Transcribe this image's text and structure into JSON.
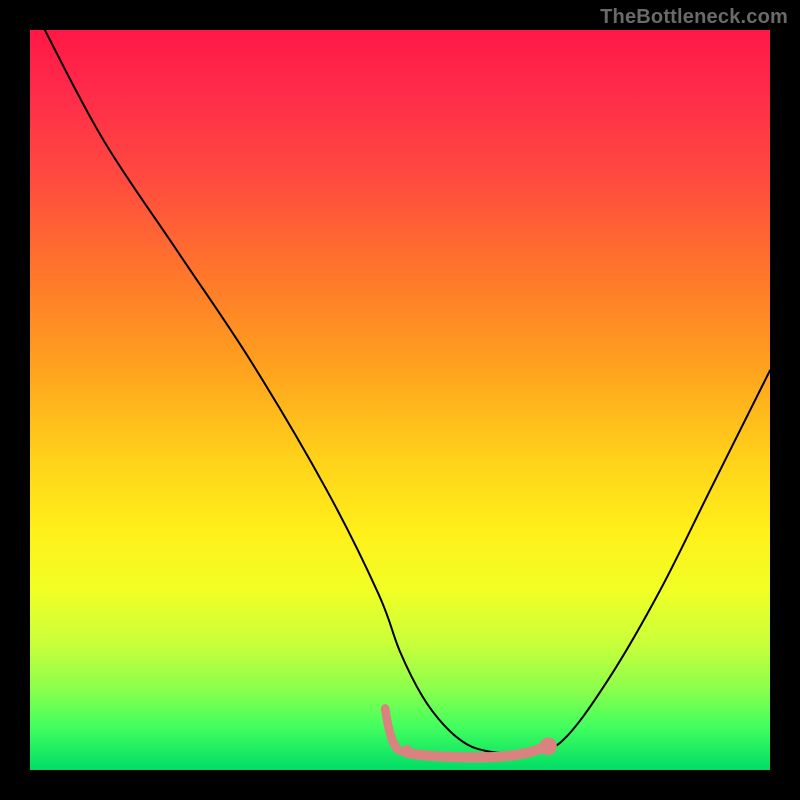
{
  "watermark": "TheBottleneck.com",
  "chart_data": {
    "type": "line",
    "title": "",
    "xlabel": "",
    "ylabel": "",
    "xlim": [
      0,
      100
    ],
    "ylim": [
      0,
      100
    ],
    "series": [
      {
        "name": "bottleneck-curve",
        "x": [
          2,
          10,
          20,
          30,
          40,
          47,
          50,
          53,
          56,
          59,
          62,
          65,
          68,
          72,
          78,
          85,
          92,
          100
        ],
        "y": [
          100,
          85,
          70,
          55,
          38,
          24,
          16,
          10,
          6,
          3.5,
          2.5,
          2.3,
          2.5,
          4,
          12,
          24,
          38,
          54
        ]
      }
    ],
    "flat_zone": {
      "comment": "pink highlight marking the low-bottleneck region on the x axis",
      "x_start": 51,
      "x_end": 70,
      "y": 2.3,
      "thickness": 2.4,
      "color": "#d9827f",
      "end_dot_x": 70,
      "end_dot_y": 3.2,
      "end_dot_r": 1.2
    },
    "curve_color": "#000000",
    "curve_width": 2
  }
}
